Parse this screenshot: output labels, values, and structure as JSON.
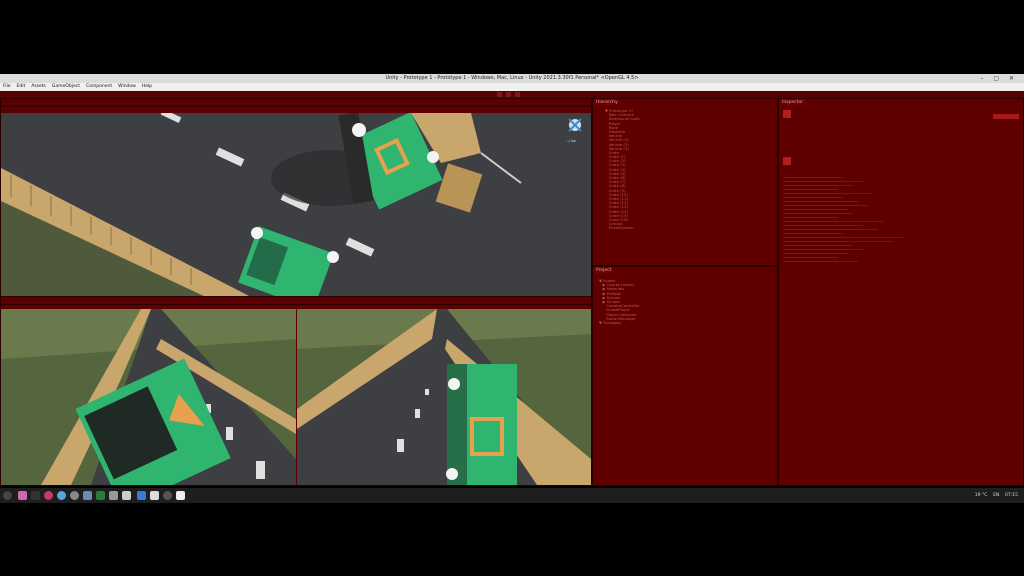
{
  "window": {
    "title": "Unity - Prototype 1 - Prototype 1 - Windows, Mac, Linux - Unity 2021.3.30f1 Personal* <OpenGL 4.5>",
    "controls": "– ▢ ✕"
  },
  "menu": [
    "File",
    "Edit",
    "Assets",
    "GameObject",
    "Component",
    "Window",
    "Help"
  ],
  "scene_view": {
    "gizmo_label": "◁ Iso"
  },
  "panels": {
    "hierarchy": {
      "tab": "Hierarchy",
      "items": [
        "▼ Prototype 1*",
        "   Main Camera",
        "   Directional Light",
        "   Player",
        "   Road",
        "   Obstacle",
        "   Vehicle",
        "   Vehicle (1)",
        "   Vehicle (2)",
        "   Vehicle (3)",
        "   Crate",
        "   Crate (1)",
        "   Crate (2)",
        "   Crate (3)",
        "   Crate (4)",
        "   Crate (5)",
        "   Crate (6)",
        "   Crate (7)",
        "   Crate (8)",
        "   Crate (9)",
        "   Crate (10)",
        "   Crate (11)",
        "   Crate (12)",
        "   Crate (13)",
        "   Crate (14)",
        "   Crate (15)",
        "   Crate (16)",
        "   Canvas",
        "   EventSystem"
      ]
    },
    "project": {
      "tab": "Project",
      "items": [
        "▼ Assets",
        "   ▶ Course Library",
        "   ▶ Materials",
        "   ▶ Prefabs",
        "   ▶ Scenes",
        "   ▶ Scripts",
        "      CameraController",
        "      FollowPlayer",
        "      PlayerController",
        "      SpawnManager",
        "▼ Packages"
      ]
    },
    "inspector": {
      "tab": "Inspector"
    }
  },
  "taskbar": {
    "weather": "19 °C",
    "lang": "EN",
    "clock": "07:15"
  },
  "colors": {
    "editor_bg": "#4a0000",
    "panel_bg": "#5e0000",
    "road": "#3d3f42",
    "grass": "#4f5a3c",
    "crate": "#c9a66b",
    "vehicle": "#2fb56f",
    "vehicle_emblem": "#e7a04e"
  }
}
